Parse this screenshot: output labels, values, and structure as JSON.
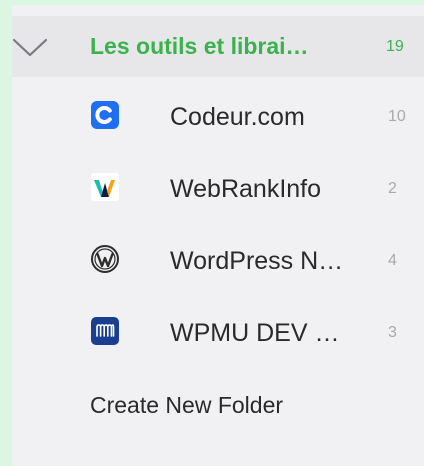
{
  "folder": {
    "label": "Les outils et librai…",
    "count": "19",
    "accent_color": "#3bb24d"
  },
  "feeds": [
    {
      "label": "Codeur.com",
      "count": "10",
      "icon": "codeur-icon"
    },
    {
      "label": "WebRankInfo",
      "count": "2",
      "icon": "webrankinfo-icon"
    },
    {
      "label": "WordPress N…",
      "count": "4",
      "icon": "wordpress-icon"
    },
    {
      "label": "WPMU DEV …",
      "count": "3",
      "icon": "wpmudev-icon"
    }
  ],
  "create_folder_label": "Create New Folder",
  "colors": {
    "background_outer": "#dcf6e4",
    "panel": "#f1f1f3",
    "folder_row": "#e7e7ea",
    "codeur_blue": "#1f6ff2",
    "wpmu_navy": "#1a3f8f"
  }
}
